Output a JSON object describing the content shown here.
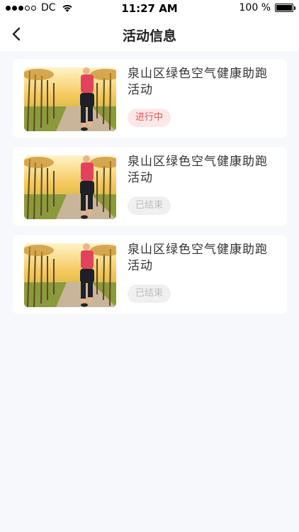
{
  "status_bar": {
    "carrier": "DC",
    "time": "11:27 AM",
    "battery": "100 %",
    "signal_icon": "signal-dots-icon",
    "wifi_icon": "wifi-icon",
    "battery_icon": "battery-icon"
  },
  "nav": {
    "title": "活动信息",
    "back_icon": "back-chevron-icon"
  },
  "activities": [
    {
      "title": "泉山区绿色空气健康助跑活动",
      "status": "进行中",
      "status_type": "active"
    },
    {
      "title": "泉山区绿色空气健康助跑活动",
      "status": "已结束",
      "status_type": "ended"
    },
    {
      "title": "泉山区绿色空气健康助跑活动",
      "status": "已结束",
      "status_type": "ended"
    }
  ],
  "colors": {
    "page_bg": "#f6f8fb",
    "active_badge_bg": "#fde8e8",
    "active_badge_text": "#e05555",
    "ended_badge_bg": "#f0f0f0",
    "ended_badge_text": "#bdbdbd"
  }
}
